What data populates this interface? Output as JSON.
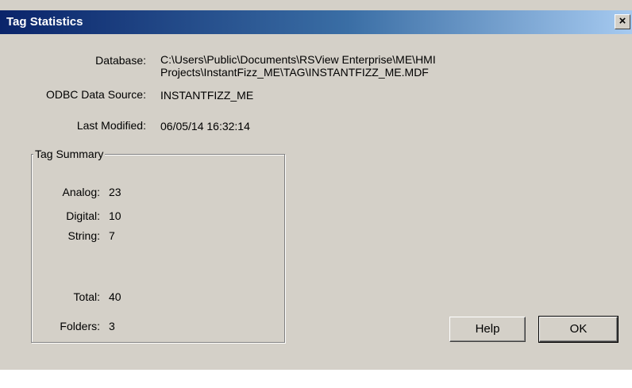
{
  "window": {
    "title": "Tag Statistics",
    "close_glyph": "×"
  },
  "info": {
    "database_label": "Database:",
    "database_value_line1": "C:\\Users\\Public\\Documents\\RSView Enterprise\\ME\\HMI",
    "database_value_line2": "Projects\\InstantFizz_ME\\TAG\\INSTANTFIZZ_ME.MDF",
    "odbc_label": "ODBC Data Source:",
    "odbc_value": "INSTANTFIZZ_ME",
    "last_modified_label": "Last Modified:",
    "last_modified_value": "06/05/14 16:32:14"
  },
  "summary": {
    "title": "Tag Summary",
    "analog_label": "Analog:",
    "analog_value": "23",
    "digital_label": "Digital:",
    "digital_value": "10",
    "string_label": "String:",
    "string_value": "7",
    "total_label": "Total:",
    "total_value": "40",
    "folders_label": "Folders:",
    "folders_value": "3"
  },
  "buttons": {
    "help": "Help",
    "ok": "OK"
  },
  "colors": {
    "dialog_bg": "#d4d0c8",
    "title_start": "#0a246a",
    "title_end": "#a6caf0"
  }
}
